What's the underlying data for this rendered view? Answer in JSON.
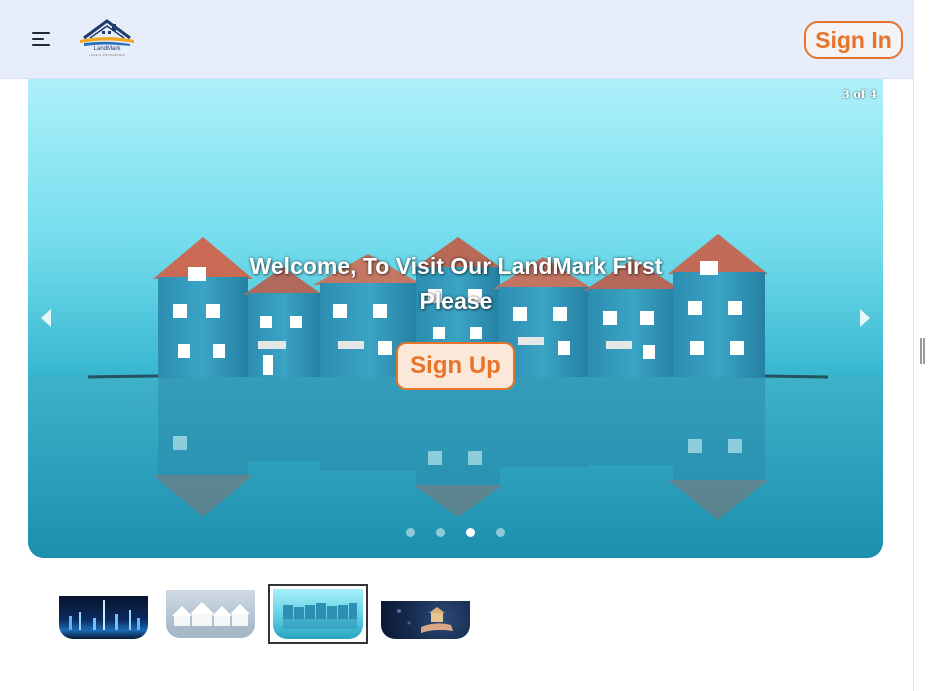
{
  "header": {
    "logo_name": "LandMark",
    "logo_tagline": "LAND & PROPERTIES",
    "signin_label": "Sign In"
  },
  "carousel": {
    "counter": "3 of 4",
    "caption": "Welcome, To Visit Our LandMark First Please",
    "signup_label": "Sign Up",
    "active_slide": 3,
    "slide_count": 4
  },
  "thumbnails": [
    {
      "name": "night-city-fountain"
    },
    {
      "name": "white-houses-reflection"
    },
    {
      "name": "blue-houses-reflection"
    },
    {
      "name": "hand-holding-house"
    }
  ],
  "colors": {
    "accent": "#e8742b",
    "header_bg": "#e8edfb",
    "house_blue": "#2e8fb0"
  },
  "icons": {
    "menu": "hamburger-menu-icon",
    "prev": "caret-left-icon",
    "next": "caret-right-icon"
  }
}
